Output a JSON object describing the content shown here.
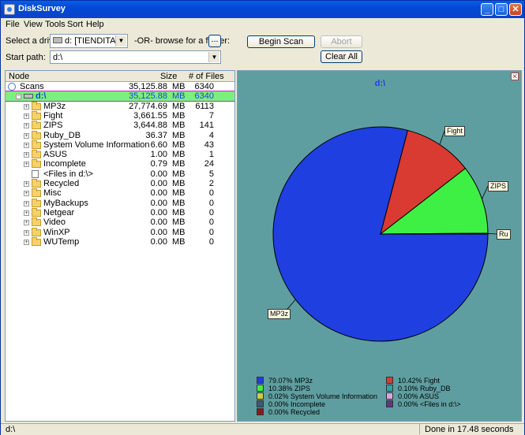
{
  "window": {
    "title": "DiskSurvey"
  },
  "menu": [
    "File",
    "View",
    "Tools",
    "Sort",
    "Help"
  ],
  "toolbar": {
    "drive_label": "Select a drive:",
    "drive_value": "d: [TIENDITA]",
    "or_label": "-OR- browse for a folder:",
    "browse_label": "...",
    "start_path_label": "Start path:",
    "start_path_value": "d:\\",
    "begin_scan": "Begin Scan",
    "abort": "Abort",
    "clear_all": "Clear All"
  },
  "tree": {
    "columns": [
      "Node",
      "Size",
      "# of Files"
    ],
    "rows": [
      {
        "name": "Scans",
        "size": "35,125.88",
        "unit": "MB",
        "files": "6340",
        "level": 0,
        "type": "scans"
      },
      {
        "name": "d:\\",
        "size": "35,125.88",
        "unit": "MB",
        "files": "6340",
        "level": 1,
        "type": "drive",
        "selected": true
      },
      {
        "name": "MP3z",
        "size": "27,774.69",
        "unit": "MB",
        "files": "6113",
        "level": 2,
        "type": "folder"
      },
      {
        "name": "Fight",
        "size": "3,661.55",
        "unit": "MB",
        "files": "7",
        "level": 2,
        "type": "folder"
      },
      {
        "name": "ZIPS",
        "size": "3,644.88",
        "unit": "MB",
        "files": "141",
        "level": 2,
        "type": "folder"
      },
      {
        "name": "Ruby_DB",
        "size": "36.37",
        "unit": "MB",
        "files": "4",
        "level": 2,
        "type": "folder"
      },
      {
        "name": "System Volume Information",
        "size": "6.60",
        "unit": "MB",
        "files": "43",
        "level": 2,
        "type": "folder"
      },
      {
        "name": "ASUS",
        "size": "1.00",
        "unit": "MB",
        "files": "1",
        "level": 2,
        "type": "folder"
      },
      {
        "name": "Incomplete",
        "size": "0.79",
        "unit": "MB",
        "files": "24",
        "level": 2,
        "type": "folder"
      },
      {
        "name": "<Files in d:\\>",
        "size": "0.00",
        "unit": "MB",
        "files": "5",
        "level": 2,
        "type": "files"
      },
      {
        "name": "Recycled",
        "size": "0.00",
        "unit": "MB",
        "files": "2",
        "level": 2,
        "type": "folder"
      },
      {
        "name": "Misc",
        "size": "0.00",
        "unit": "MB",
        "files": "0",
        "level": 2,
        "type": "folder"
      },
      {
        "name": "MyBackups",
        "size": "0.00",
        "unit": "MB",
        "files": "0",
        "level": 2,
        "type": "folder"
      },
      {
        "name": "Netgear",
        "size": "0.00",
        "unit": "MB",
        "files": "0",
        "level": 2,
        "type": "folder"
      },
      {
        "name": "Video",
        "size": "0.00",
        "unit": "MB",
        "files": "0",
        "level": 2,
        "type": "folder"
      },
      {
        "name": "WinXP",
        "size": "0.00",
        "unit": "MB",
        "files": "0",
        "level": 2,
        "type": "folder"
      },
      {
        "name": "WUTemp",
        "size": "0.00",
        "unit": "MB",
        "files": "0",
        "level": 2,
        "type": "folder"
      }
    ]
  },
  "chart_data": {
    "type": "pie",
    "title": "d:\\",
    "slices": [
      {
        "label": "MP3z",
        "percent": 79.07,
        "color": "#1f3fe0",
        "legend": "79.07% MP3z",
        "callout": "MP3z"
      },
      {
        "label": "Fight",
        "percent": 10.42,
        "color": "#d93a32",
        "legend": "10.42% Fight",
        "callout": "Fight"
      },
      {
        "label": "ZIPS",
        "percent": 10.38,
        "color": "#3ef044",
        "legend": "10.38% ZIPS",
        "callout": "ZIPS"
      },
      {
        "label": "Ruby_DB",
        "percent": 0.1,
        "color": "#2aa6a6",
        "legend": "0.10% Ruby_DB",
        "callout": "Ru"
      },
      {
        "label": "System Volume Information",
        "percent": 0.02,
        "color": "#c8d040",
        "legend": "0.02% System Volume Information",
        "callout": ""
      },
      {
        "label": "ASUS",
        "percent": 0.0,
        "color": "#d6a8dc",
        "legend": "0.00% ASUS",
        "callout": ""
      },
      {
        "label": "Incomplete",
        "percent": 0.0,
        "color": "#3a5a78",
        "legend": "0.00% Incomplete",
        "callout": ""
      },
      {
        "label": "<Files in d:\\>",
        "percent": 0.0,
        "color": "#5a3a86",
        "legend": "0.00% <Files in d:\\>",
        "callout": ""
      },
      {
        "label": "Recycled",
        "percent": 0.0,
        "color": "#8a1a1a",
        "legend": "0.00% Recycled",
        "callout": ""
      }
    ]
  },
  "status": {
    "path": "d:\\",
    "message": "Done in 17.48  seconds"
  }
}
